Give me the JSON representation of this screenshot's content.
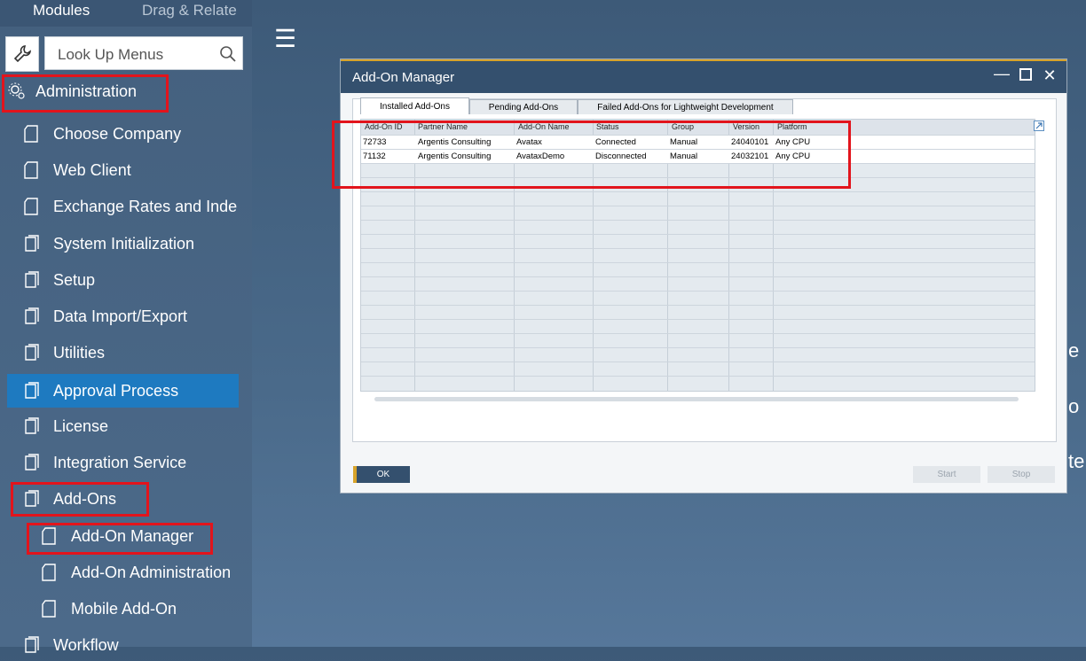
{
  "sidebar": {
    "tabs": [
      "Modules",
      "Drag & Relate"
    ],
    "search_placeholder": "Look Up Menus",
    "section_label": "Administration",
    "items": [
      {
        "label": "Choose Company",
        "icon": "document-icon"
      },
      {
        "label": "Web Client",
        "icon": "document-icon"
      },
      {
        "label": "Exchange Rates and Inde",
        "icon": "document-icon"
      },
      {
        "label": "System Initialization",
        "icon": "folder-icon"
      },
      {
        "label": "Setup",
        "icon": "folder-icon"
      },
      {
        "label": "Data Import/Export",
        "icon": "folder-icon"
      },
      {
        "label": "Utilities",
        "icon": "folder-icon"
      },
      {
        "label": "Approval Process",
        "icon": "folder-icon",
        "selected": true
      },
      {
        "label": "License",
        "icon": "folder-icon"
      },
      {
        "label": "Integration Service",
        "icon": "folder-icon"
      },
      {
        "label": "Add-Ons",
        "icon": "folder-icon"
      }
    ],
    "subitems": [
      {
        "label": "Add-On Manager",
        "icon": "document-icon"
      },
      {
        "label": "Add-On Administration",
        "icon": "document-icon"
      },
      {
        "label": "Mobile Add-On",
        "icon": "document-icon"
      }
    ],
    "last_item": "Workflow"
  },
  "background_text": [
    "e",
    "o",
    "te"
  ],
  "window": {
    "title": "Add-On Manager",
    "tabs": [
      "Installed Add-Ons",
      "Pending Add-Ons",
      "Failed Add-Ons for Lightweight Development"
    ],
    "columns": [
      "Add-On ID",
      "Partner Name",
      "Add-On Name",
      "Status",
      "Group",
      "Version",
      "Platform"
    ],
    "rows": [
      [
        "72733",
        "Argentis Consulting",
        "Avatax",
        "Connected",
        "Manual",
        "24040101",
        "Any CPU"
      ],
      [
        "71132",
        "Argentis Consulting",
        "AvataxDemo",
        "Disconnected",
        "Manual",
        "24032101",
        "Any CPU"
      ]
    ],
    "buttons": {
      "ok": "OK",
      "start": "Start",
      "stop": "Stop"
    }
  },
  "colors": {
    "accent": "#1e7ac0",
    "titlebar": "#34506e",
    "highlight_border": "#e2141c",
    "gold": "#d7a32a"
  }
}
